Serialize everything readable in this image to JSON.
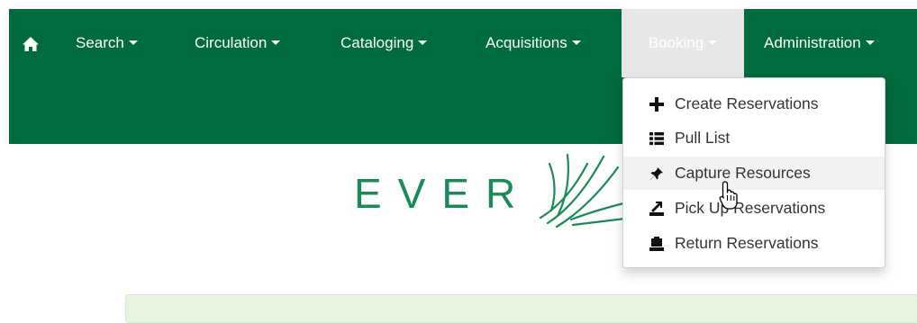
{
  "navbar": {
    "home_icon": "home-icon",
    "items": [
      {
        "label": "Search"
      },
      {
        "label": "Circulation"
      },
      {
        "label": "Cataloging"
      },
      {
        "label": "Acquisitions"
      },
      {
        "label": "Booking"
      },
      {
        "label": "Administration"
      }
    ],
    "active_item": "Booking",
    "colors": {
      "background": "#006b3c",
      "active_background": "#e7e7e7",
      "text": "#ffffff"
    }
  },
  "logo": {
    "text": "EVER",
    "brand_color": "#1a8a57"
  },
  "booking_menu": {
    "items": [
      {
        "label": "Create Reservations",
        "icon": "plus-icon"
      },
      {
        "label": "Pull List",
        "icon": "list-icon"
      },
      {
        "label": "Capture Resources",
        "icon": "pushpin-icon"
      },
      {
        "label": "Pick Up Reservations",
        "icon": "pick-up-icon"
      },
      {
        "label": "Return Reservations",
        "icon": "return-icon"
      }
    ],
    "hovered_item": "Capture Resources"
  },
  "cursor": {
    "icon": "hand-pointer-icon"
  }
}
